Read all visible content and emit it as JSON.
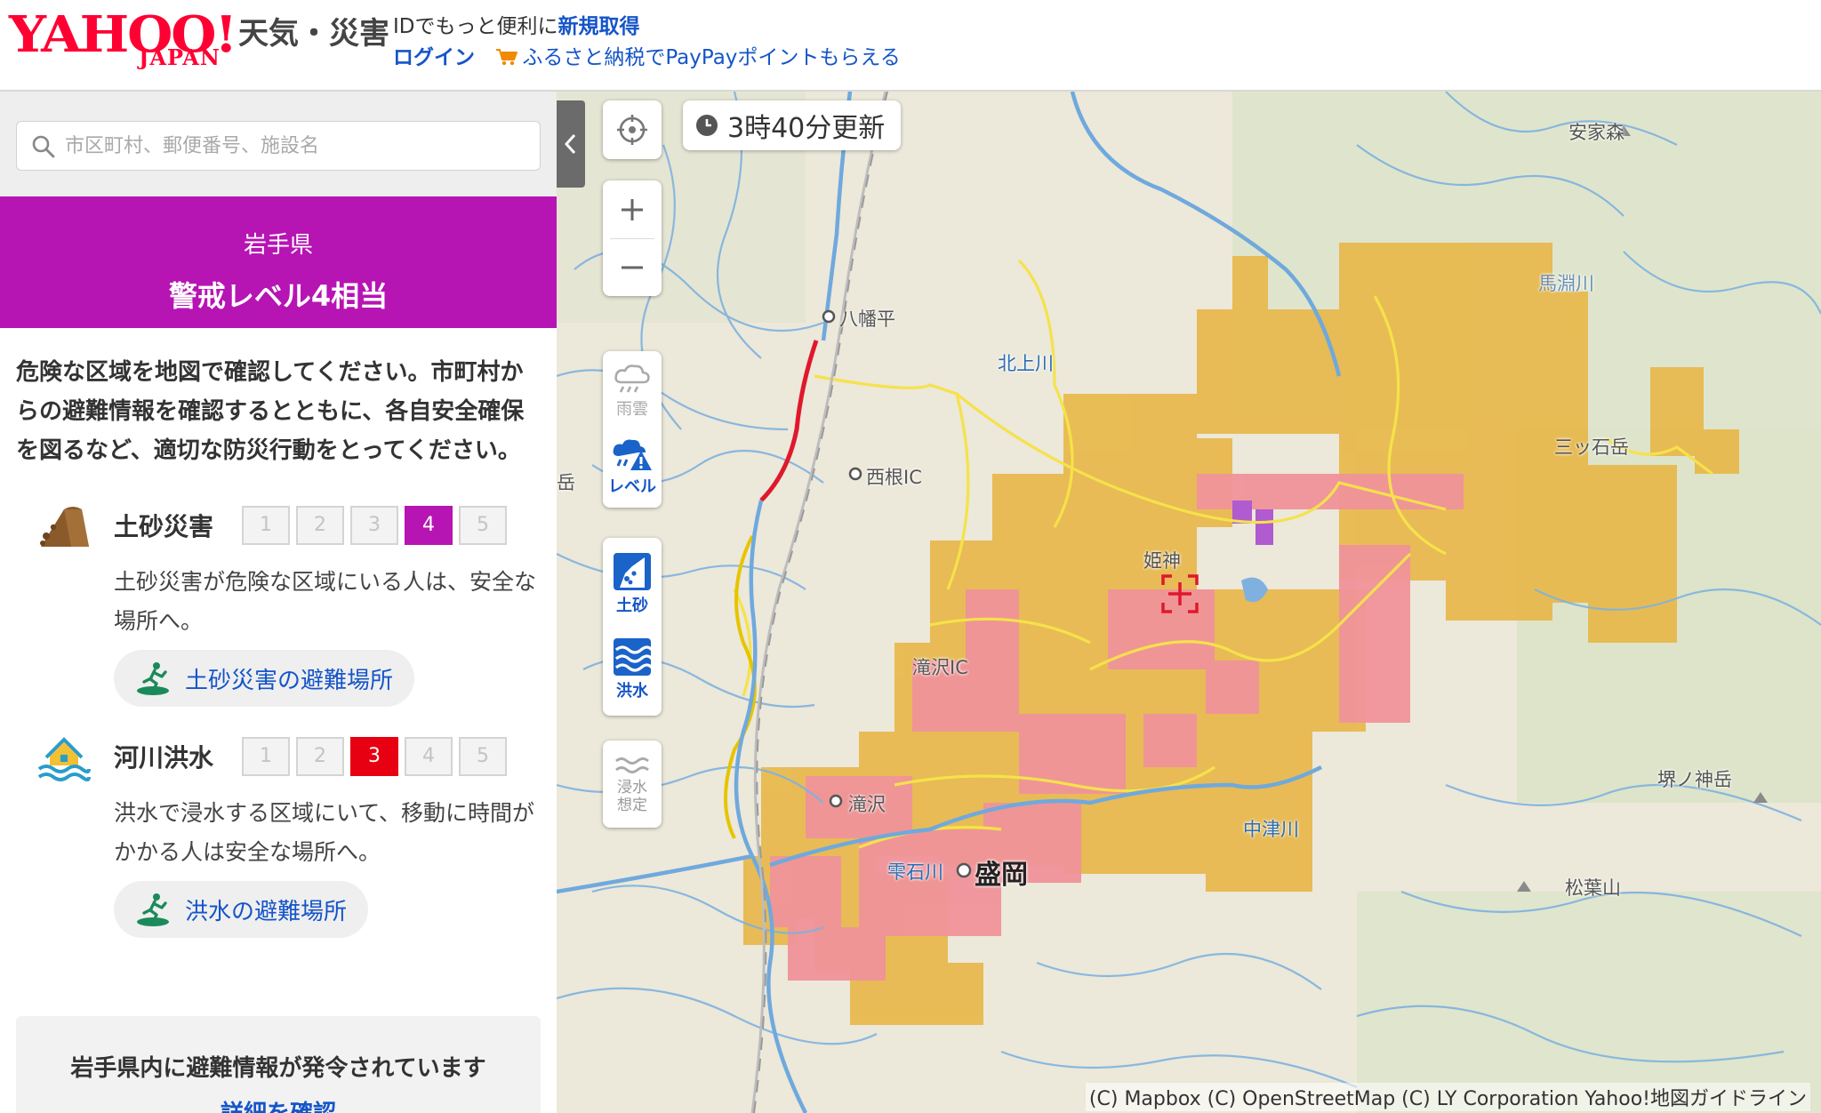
{
  "header": {
    "logo_main": "YAHOO!",
    "logo_sub": "JAPAN",
    "service_name": "天気・災害",
    "id_text": "IDでもっと便利に",
    "signup_link": "新規取得",
    "login_link": "ログイン",
    "promo_link": "ふるさと納税でPayPayポイントもらえる"
  },
  "search": {
    "placeholder": "市区町村、郵便番号、施設名",
    "value": ""
  },
  "alert": {
    "prefecture": "岩手県",
    "level_label": "警戒レベル4相当"
  },
  "notice": "危険な区域を地図で確認してください。市町村からの避難情報を確認するとともに、各自安全確保を図るなど、適切な防災行動をとってください。",
  "hazards": [
    {
      "title": "土砂災害",
      "icon": "landslide-icon",
      "levels": [
        "1",
        "2",
        "3",
        "4",
        "5"
      ],
      "active_level": 4,
      "active_color": "#b714b4",
      "description": "土砂災害が危険な区域にいる人は、安全な場所へ。",
      "evac_label": "土砂災害の避難場所"
    },
    {
      "title": "河川洪水",
      "icon": "flood-house-icon",
      "levels": [
        "1",
        "2",
        "3",
        "4",
        "5"
      ],
      "active_level": 3,
      "active_color": "#e60012",
      "description": "洪水で浸水する区域にいて、移動に時間がかかる人は安全な場所へ。",
      "evac_label": "洪水の避難場所"
    }
  ],
  "info_box": {
    "text": "岩手県内に避難情報が発令されています",
    "link": "詳細を確認"
  },
  "map": {
    "update_time": "3時40分更新",
    "controls": {
      "rain_label": "雨雲",
      "level_label": "レベル",
      "landslide_label": "土砂",
      "flood_label": "洪水",
      "inundation_label": "浸水想定"
    },
    "labels": {
      "hachimantai": "八幡平",
      "kitakami_river": "北上川",
      "nishine_ic": "西根IC",
      "takizawa_ic": "滝沢IC",
      "takizawa": "滝沢",
      "shizukuishi_river": "雫石川",
      "morioka": "盛岡",
      "nakatsu_river": "中津川",
      "mabechi_river": "馬淵川",
      "mt_matsuba": "松葉山",
      "anja_mori": "安家森",
      "tastsusou_dake": "三ッ石岳",
      "sakai_kamisaki": "堺ノ神岳",
      "himekami": "姫神",
      "left_dake": "岳"
    },
    "attribution": "(C) Mapbox (C) OpenStreetMap (C) LY Corporation Yahoo!地図ガイドライン"
  },
  "colors": {
    "brand_red": "#ff0033",
    "alert_purple": "#b714b4",
    "warning_red": "#e60012",
    "link_blue": "#1555c8",
    "hazard_orange": "#e8b84b",
    "hazard_pink": "#f0939a"
  }
}
